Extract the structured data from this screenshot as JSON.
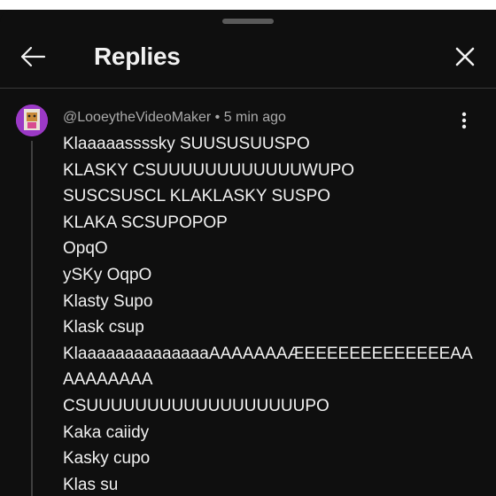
{
  "header": {
    "title": "Replies"
  },
  "comment": {
    "author": "@LooeytheVideoMaker",
    "separator": "•",
    "time": "5 min ago",
    "lines": [
      "Klaaaaassssky SUUSUSUUSPO",
      "KLASKY CSUUUUUUUUUUUUWUPO",
      "SUSCSUSCL KLAKLASKY SUSPO",
      "KLAKA SCSUPOPOP",
      "OpqO",
      "ySKy OqpO",
      "Klasty Supo",
      "Klask csup",
      "KlaaaaaaaaaaaaaaAAAAAAAÆEEEEEEEEEEEEEAA",
      "AAAAAAAA",
      "CSUUUUUUUUUUUUUUUUUUPO",
      "Kaka caiidy",
      "Kasky cupo",
      "Klas su"
    ]
  },
  "icons": {
    "back": "arrow-left-icon",
    "close": "close-icon",
    "more": "more-vert-icon"
  },
  "colors": {
    "background": "#0f0f0f",
    "text": "#f1f1f1",
    "meta_text": "#aaaaaa",
    "avatar_bg": "#9b39c6"
  }
}
